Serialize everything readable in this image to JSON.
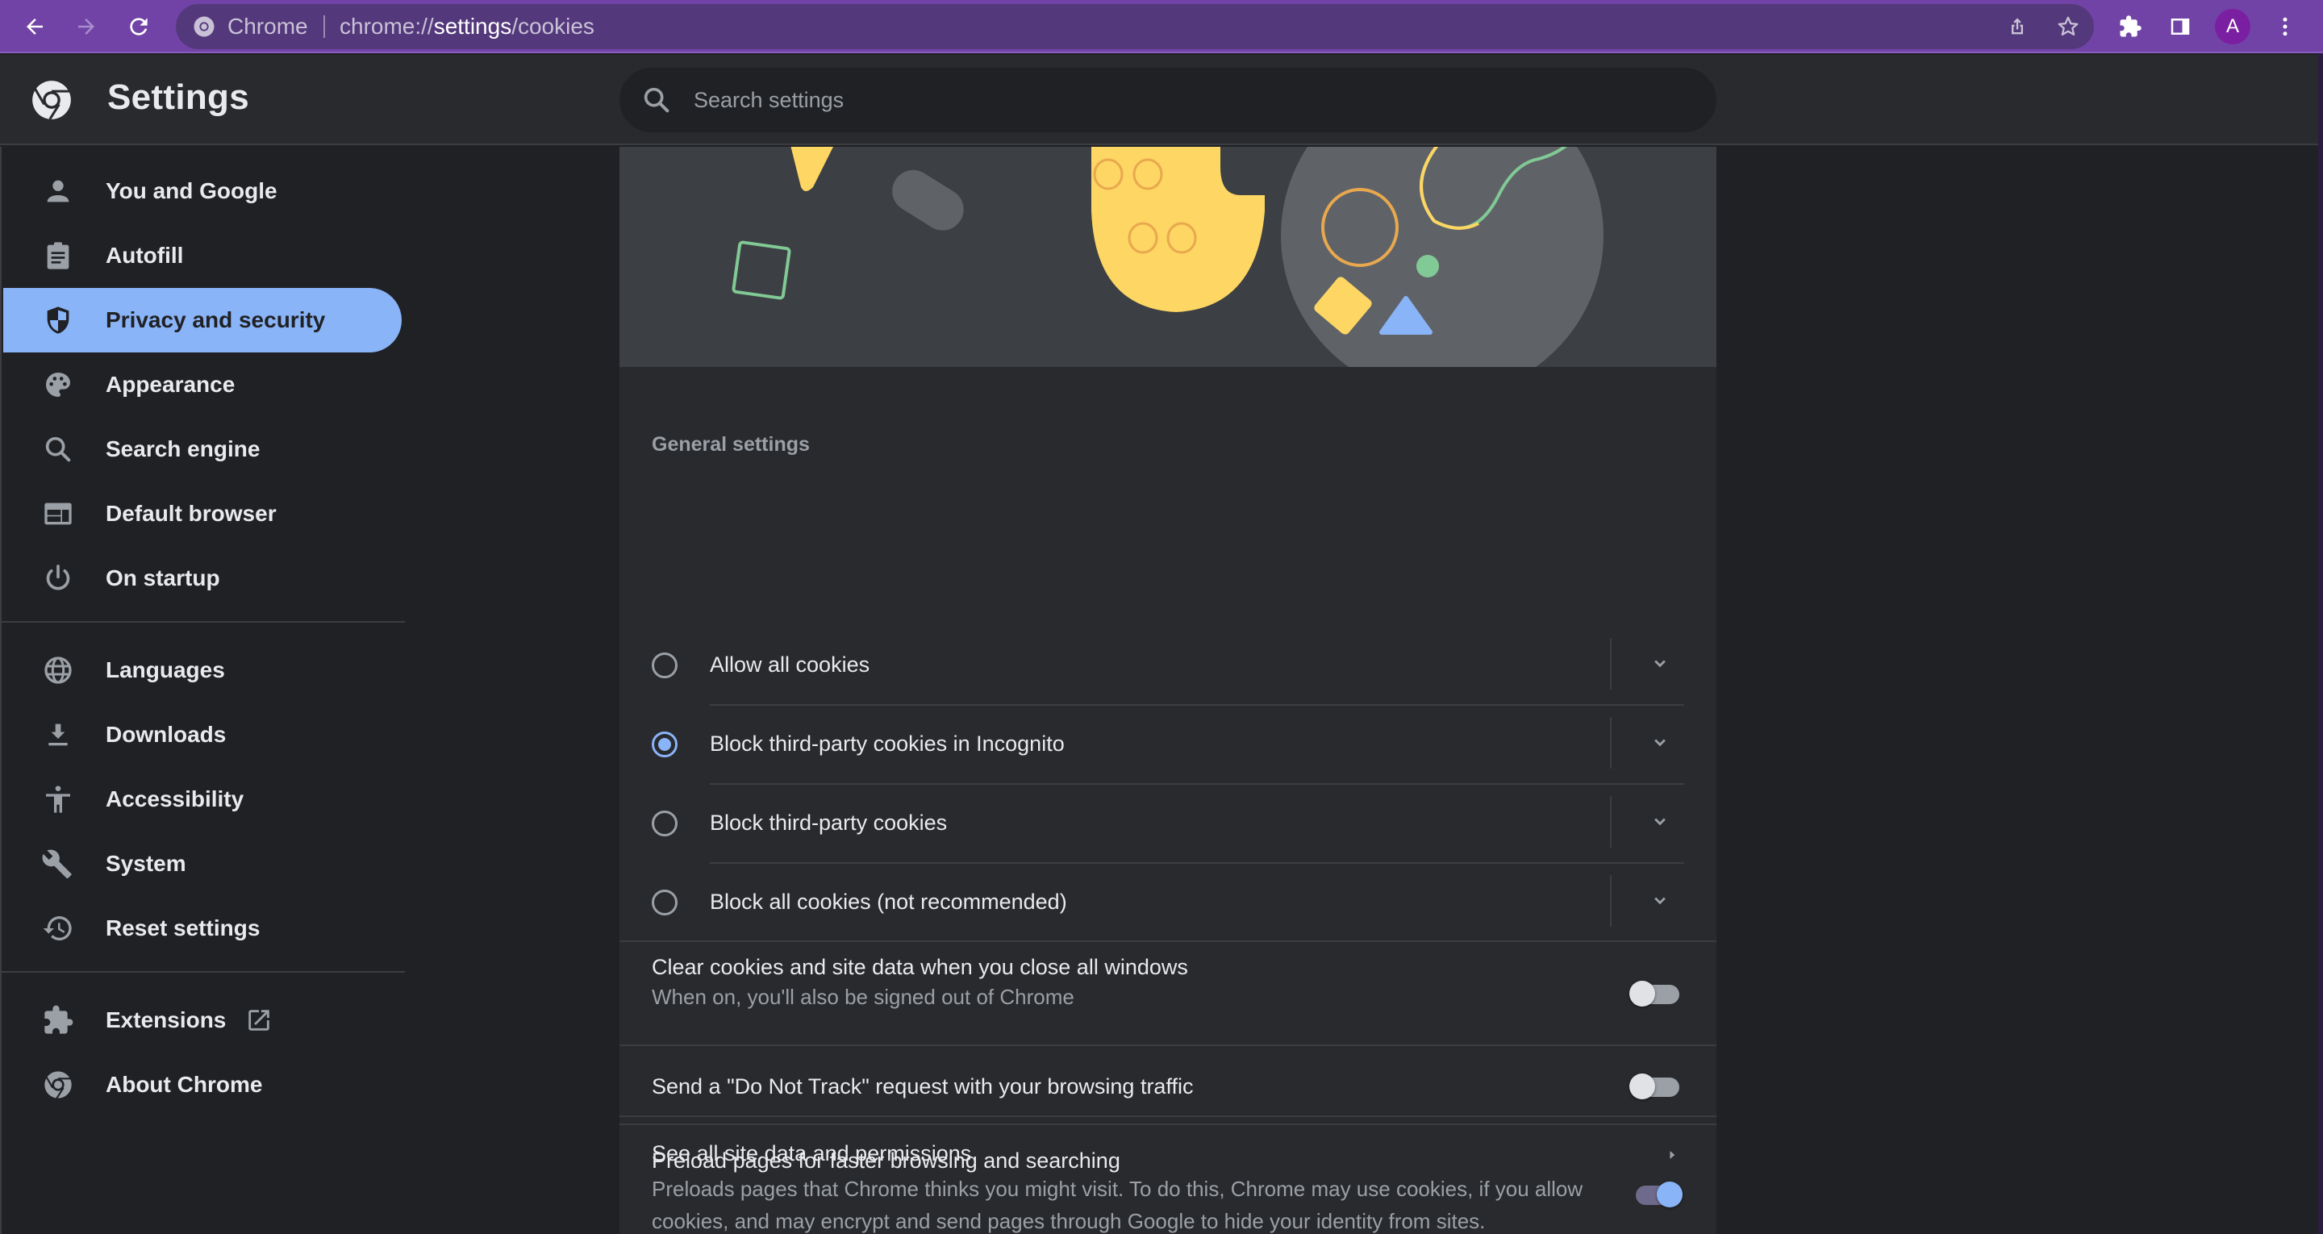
{
  "browser": {
    "site_name": "Chrome",
    "url_prefix": "chrome://",
    "url_host": "settings",
    "url_path": "/cookies",
    "profile_initial": "A",
    "accent_color": "#7143a6"
  },
  "header": {
    "title": "Settings",
    "search_placeholder": "Search settings"
  },
  "sidebar": {
    "items": [
      {
        "label": "You and Google",
        "icon": "person-icon"
      },
      {
        "label": "Autofill",
        "icon": "clipboard-icon"
      },
      {
        "label": "Privacy and security",
        "icon": "shield-icon",
        "active": true
      },
      {
        "label": "Appearance",
        "icon": "palette-icon"
      },
      {
        "label": "Search engine",
        "icon": "search-icon"
      },
      {
        "label": "Default browser",
        "icon": "browser-window-icon"
      },
      {
        "label": "On startup",
        "icon": "power-icon"
      },
      {
        "label": "Languages",
        "icon": "globe-icon"
      },
      {
        "label": "Downloads",
        "icon": "download-icon"
      },
      {
        "label": "Accessibility",
        "icon": "accessibility-icon"
      },
      {
        "label": "System",
        "icon": "wrench-icon"
      },
      {
        "label": "Reset settings",
        "icon": "history-icon"
      },
      {
        "label": "Extensions",
        "icon": "puzzle-icon"
      },
      {
        "label": "About Chrome",
        "icon": "chrome-icon"
      }
    ]
  },
  "main": {
    "section_title": "General settings",
    "cookie_options": [
      {
        "label": "Allow all cookies",
        "selected": false
      },
      {
        "label": "Block third-party cookies in Incognito",
        "selected": true
      },
      {
        "label": "Block third-party cookies",
        "selected": false
      },
      {
        "label": "Block all cookies (not recommended)",
        "selected": false
      }
    ],
    "toggles": [
      {
        "title": "Clear cookies and site data when you close all windows",
        "subtitle": "When on, you'll also be signed out of Chrome",
        "on": false
      },
      {
        "title": "Send a \"Do Not Track\" request with your browsing traffic",
        "subtitle": "",
        "on": false
      },
      {
        "title": "Preload pages for faster browsing and searching",
        "subtitle": "Preloads pages that Chrome thinks you might visit. To do this, Chrome may use cookies, if you allow cookies, and may encrypt and send pages through Google to hide your identity from sites.",
        "on": true
      }
    ],
    "link_row": {
      "label": "See all site data and permissions"
    },
    "selected_color": "#8ab4f8"
  }
}
